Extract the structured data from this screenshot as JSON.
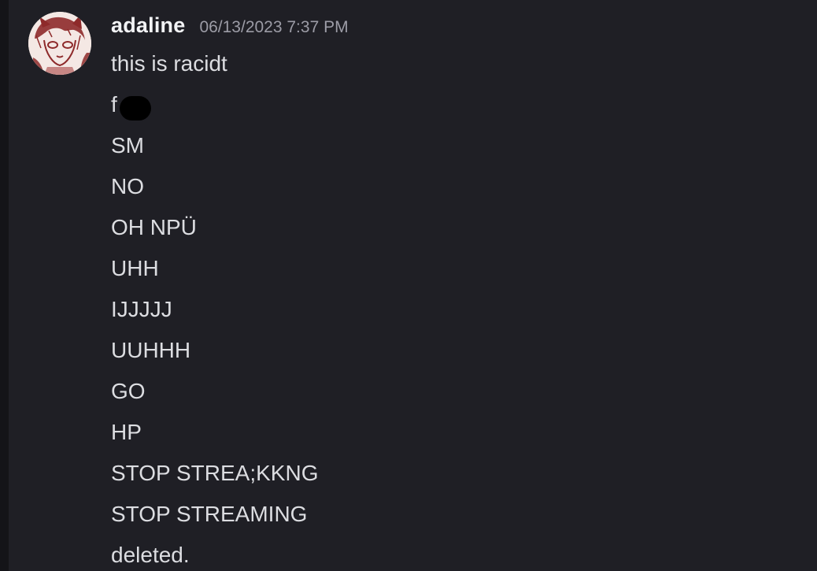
{
  "message": {
    "username": "adaline",
    "timestamp": "06/13/2023 7:37 PM",
    "avatar_icon": "anime-sketch-avatar-icon",
    "lines": [
      "this is racidt",
      "f",
      "SM",
      "NO",
      "OH NPÜ",
      "UHH",
      "IJJJJJ",
      "UUHHH",
      "GO",
      "HP",
      "STOP STREA;KKNG",
      "STOP STREAMING",
      "deleted."
    ]
  },
  "colors": {
    "background": "#1f1f25",
    "username": "#f2f3f5",
    "timestamp": "#9c9ca6",
    "text": "#dcdde1",
    "censor": "#000000"
  }
}
